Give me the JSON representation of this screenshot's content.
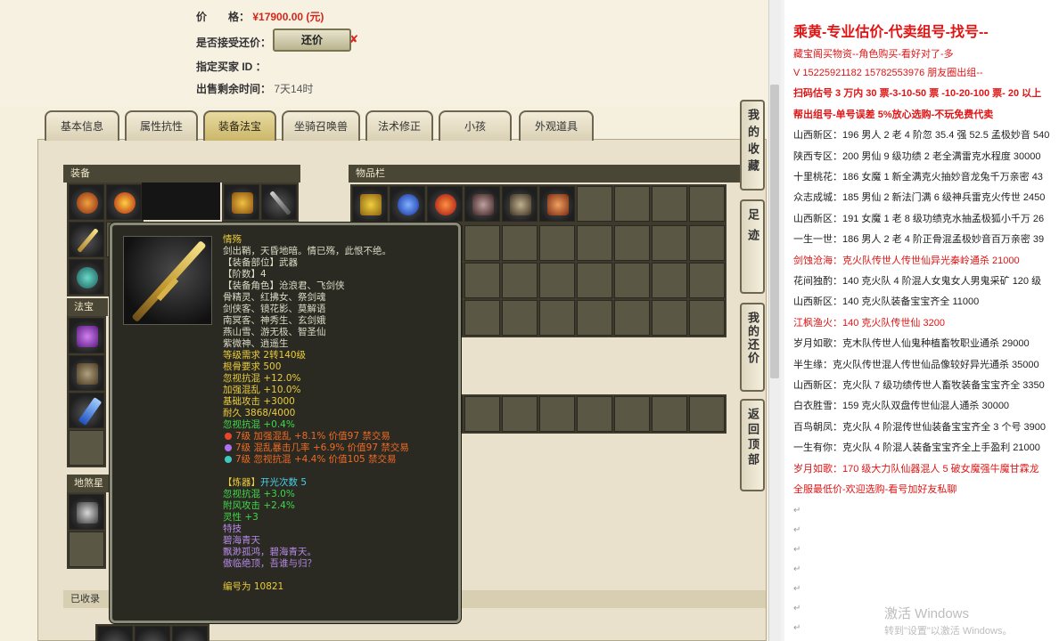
{
  "listing": {
    "price_label": "价　　格：",
    "price_value": "¥17900.00 (元)",
    "counter_label": "是否接受还价：",
    "counter_button": "还价",
    "counter_mark": "✘",
    "buyer_label": "指定买家 ID ：",
    "buyer_value": "",
    "time_label": "出售剩余时间：",
    "time_value": "7天14时"
  },
  "tabs": [
    {
      "label": "基本信息",
      "active": false
    },
    {
      "label": "属性抗性",
      "active": false
    },
    {
      "label": "装备法宝",
      "active": true
    },
    {
      "label": "坐骑召唤兽",
      "active": false
    },
    {
      "label": "法术修正",
      "active": false
    },
    {
      "label": "小孩",
      "active": false
    },
    {
      "label": "外观道具",
      "active": false
    }
  ],
  "sections": {
    "equipment": "装备",
    "inventory": "物品栏",
    "treasure": "法宝",
    "land_treasure": "地煞星",
    "collected": "已收录"
  },
  "side_tabs": [
    "我的收藏",
    "足迹",
    "我的还价",
    "返回顶部"
  ],
  "tooltip": {
    "name": "情殇",
    "desc": "剑出鞘，天昏地暗。情已殇，此恨不绝。",
    "slot": "【装备部位】武器",
    "tier_label": "【阶数】4",
    "roles_label": "【装备角色】沧浪君、飞剑侠",
    "roles": [
      "骨精灵、红拂女、祭剑魂",
      "剑侠客、镜花影、莫解语",
      "南冥客、神秀生、玄剑娥",
      "燕山雪、游无极、智圣仙",
      "紫微神、逍遥生"
    ],
    "level_req": "等级需求 2转140级",
    "bone_req": "根骨要求 500",
    "stats": [
      "忽视抗混 +12.0%",
      "加强混乱 +10.0%",
      "基础攻击 +3000"
    ],
    "durability": "耐久 3868/4000",
    "stat_green": "忽视抗混 +0.4%",
    "gems": [
      {
        "text": "7级 加强混乱 +8.1% 价值97 禁交易",
        "color": "#e8462a"
      },
      {
        "text": "7级 混乱暴击几率 +6.9% 价值97 禁交易",
        "color": "#b070f0"
      },
      {
        "text": "7级 忽视抗混 +4.4% 价值105 禁交易",
        "color": "#40c8c0"
      }
    ],
    "refine_label": "【炼器】",
    "refine_count": "开光次数 5",
    "refine_stats": [
      "忽视抗混 +3.0%",
      "附风攻击 +2.4%",
      "灵性 +3"
    ],
    "skill_label": "特技",
    "skill_name": "碧海青天",
    "skill_desc": [
      "飘渺孤鸿，碧海青天。",
      "傲临绝顶，吾谁与归？"
    ],
    "serial": "编号为 10821"
  },
  "doc": {
    "title": "乘黄-专业估价-代卖组号-找号--",
    "lines": [
      {
        "text": "藏宝阁买物资--角色购买-看好对了-多",
        "cls": "red"
      },
      {
        "text": "V 15225921182   15782553976 朋友圈出组--",
        "cls": "red"
      },
      {
        "text": "扫码估号 3 万内 30 票-3-10-50 票  -10-20-100 票- 20 以上",
        "cls": "red bold"
      },
      {
        "text": "帮出组号-单号误差 5%放心选购-不玩免费代卖",
        "cls": "red bold"
      },
      {
        "text": "山西新区：196 男人 2 老 4 阶忽 35.4 强 52.5 孟极妙音 540",
        "cls": ""
      },
      {
        "text": "陕西专区：200 男仙 9 级功绩 2 老全满雷克水程度 30000",
        "cls": ""
      },
      {
        "text": "十里桃花：186 女魔 1 新全满克火抽妙音龙兔千万亲密 43",
        "cls": ""
      },
      {
        "text": "众志成城：185 男仙 2 新法门满 6 级神兵雷克火传世 2450",
        "cls": ""
      },
      {
        "text": "山西新区：191 女魔 1 老 8 级功绩克水抽孟极狐小千万 26",
        "cls": ""
      },
      {
        "text": "一生一世：186 男人 2 老 4 阶正骨混孟极妙音百万亲密 39",
        "cls": ""
      },
      {
        "text": "剑蚀沧海：克火队传世人传世仙异光秦岭通杀 21000",
        "cls": "red"
      },
      {
        "text": "花间独酌：140 克火队 4 阶混人女鬼女人男鬼采矿 120 级",
        "cls": ""
      },
      {
        "text": "山西新区：140 克火队装备宝宝齐全 11000",
        "cls": ""
      },
      {
        "text": "江枫渔火：140 克火队传世仙 3200",
        "cls": "red"
      },
      {
        "text": "岁月如歌：克木队传世人仙鬼种植畜牧职业通杀 29000",
        "cls": ""
      },
      {
        "text": "半生缘：克火队传世混人传世仙品像较好异光通杀 35000",
        "cls": ""
      },
      {
        "text": "山西新区：克火队 7 级功绩传世人畜牧装备宝宝齐全 3350",
        "cls": ""
      },
      {
        "text": "白衣胜雪：159 克火队双盘传世仙混人通杀 30000",
        "cls": ""
      },
      {
        "text": "百鸟朝凤：克火队 4 阶混传世仙装备宝宝齐全 3 个号 3900",
        "cls": ""
      },
      {
        "text": "一生有你：克火队 4 阶混人装备宝宝齐全上手盈利 21000",
        "cls": ""
      },
      {
        "text": "岁月如歌：170 级大力队仙器混人 5 破女魔强牛魔甘霖龙",
        "cls": "red"
      },
      {
        "text": "全服最低价-欢迎选购-看号加好友私聊",
        "cls": "red"
      }
    ],
    "return_mark": "↵",
    "watermark_title": "激活 Windows",
    "watermark_sub": "转到\"设置\"以激活 Windows。"
  }
}
